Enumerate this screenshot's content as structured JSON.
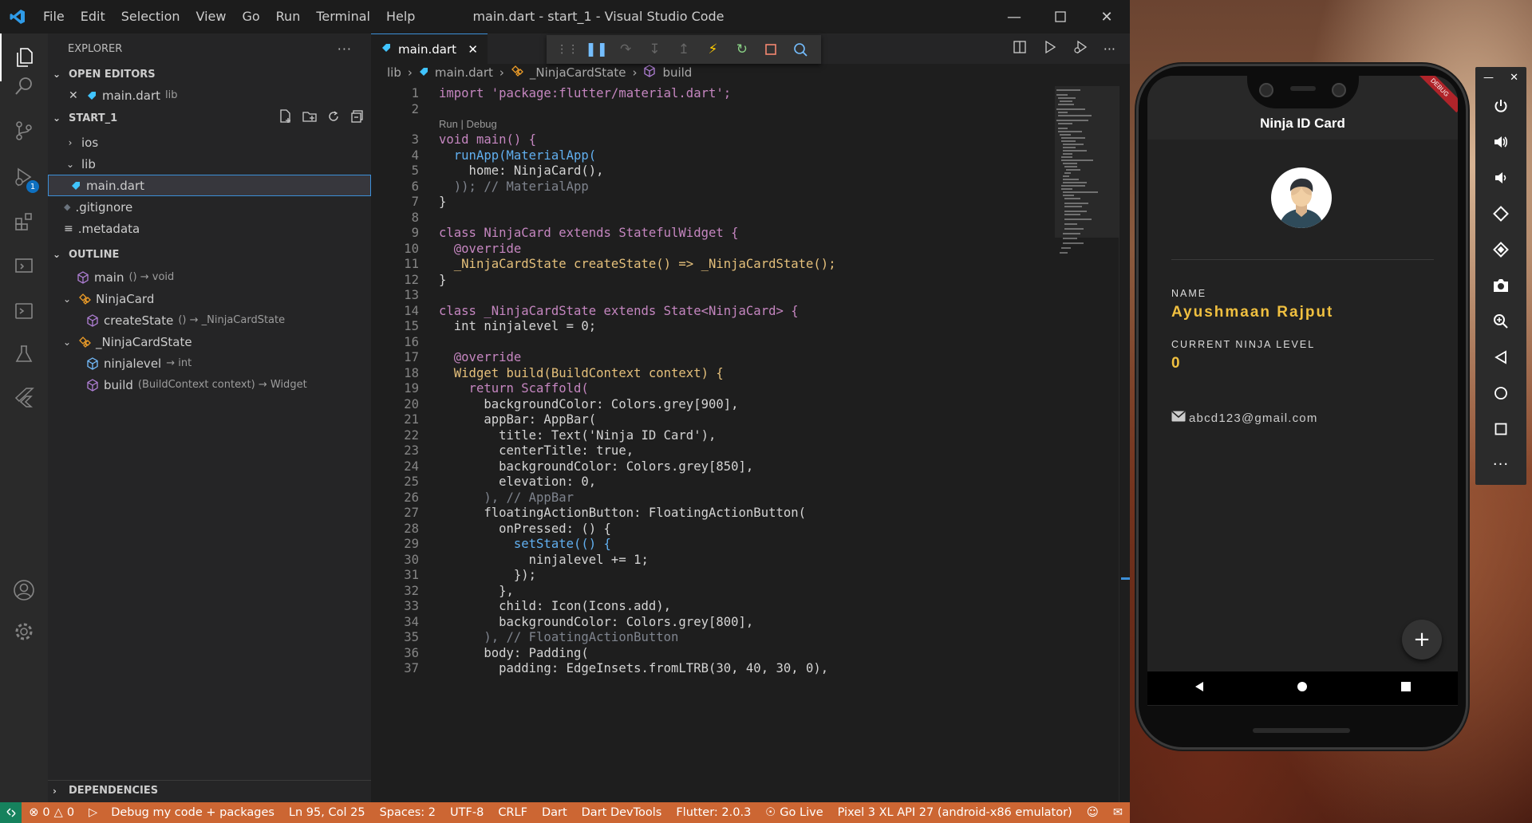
{
  "window": {
    "title": "main.dart - start_1 - Visual Studio Code",
    "menu": [
      "File",
      "Edit",
      "Selection",
      "View",
      "Go",
      "Run",
      "Terminal",
      "Help"
    ]
  },
  "activity": {
    "debug_badge": "1"
  },
  "sidebar": {
    "header": "EXPLORER",
    "open_editors": {
      "title": "OPEN EDITORS",
      "items": [
        {
          "name": "main.dart",
          "path": "lib"
        }
      ]
    },
    "project": {
      "title": "START_1",
      "items": [
        {
          "name": "ios",
          "type": "folder",
          "expanded": false
        },
        {
          "name": "lib",
          "type": "folder",
          "expanded": true
        },
        {
          "name": "main.dart",
          "type": "file",
          "selected": true
        },
        {
          "name": ".gitignore",
          "type": "file"
        },
        {
          "name": ".metadata",
          "type": "file"
        }
      ]
    },
    "outline": {
      "title": "OUTLINE",
      "items": [
        {
          "name": "main",
          "detail": "() → void"
        },
        {
          "name": "NinjaCard",
          "detail": ""
        },
        {
          "name": "createState",
          "detail": "() → _NinjaCardState"
        },
        {
          "name": "_NinjaCardState",
          "detail": ""
        },
        {
          "name": "ninjalevel",
          "detail": "→ int"
        },
        {
          "name": "build",
          "detail": "(BuildContext context) → Widget"
        }
      ]
    },
    "dependencies": {
      "title": "DEPENDENCIES"
    }
  },
  "editor": {
    "tab": "main.dart",
    "breadcrumbs": [
      "lib",
      "main.dart",
      "_NinjaCardState",
      "build"
    ],
    "codelens": "Run | Debug",
    "line_numbers": [
      "1",
      "2",
      "3",
      "4",
      "5",
      "6",
      "7",
      "8",
      "9",
      "10",
      "11",
      "12",
      "13",
      "14",
      "15",
      "16",
      "17",
      "18",
      "19",
      "20",
      "21",
      "22",
      "23",
      "24",
      "25",
      "26",
      "27",
      "28",
      "29",
      "30",
      "31",
      "32",
      "33",
      "34",
      "35",
      "36",
      "37"
    ],
    "code": {
      "l1": "import 'package:flutter/material.dart';",
      "l3": "void main() {",
      "l4": "  runApp(MaterialApp(",
      "l5": "    home: NinjaCard(),",
      "l6": "  )); // MaterialApp",
      "l7": "}",
      "l9": "class NinjaCard extends StatefulWidget {",
      "l10": "  @override",
      "l11": "  _NinjaCardState createState() => _NinjaCardState();",
      "l12": "}",
      "l14": "class _NinjaCardState extends State<NinjaCard> {",
      "l15": "  int ninjalevel = 0;",
      "l17": "  @override",
      "l18": "  Widget build(BuildContext context) {",
      "l19": "    return Scaffold(",
      "l20": "      backgroundColor: Colors.grey[900],",
      "l21": "      appBar: AppBar(",
      "l22": "        title: Text('Ninja ID Card'),",
      "l23": "        centerTitle: true,",
      "l24": "        backgroundColor: Colors.grey[850],",
      "l25": "        elevation: 0,",
      "l26": "      ), // AppBar",
      "l27": "      floatingActionButton: FloatingActionButton(",
      "l28": "        onPressed: () {",
      "l29": "          setState(() {",
      "l30": "            ninjalevel += 1;",
      "l31": "          });",
      "l32": "        },",
      "l33": "        child: Icon(Icons.add),",
      "l34": "        backgroundColor: Colors.grey[800],",
      "l35": "      ), // FloatingActionButton",
      "l36": "      body: Padding(",
      "l37": "        padding: EdgeInsets.fromLTRB(30, 40, 30, 0),"
    }
  },
  "statusbar": {
    "problems": "0",
    "warnings": "0",
    "debug_config": "Debug my code + packages",
    "position": "Ln 95, Col 25",
    "spaces": "Spaces: 2",
    "encoding": "UTF-8",
    "eol": "CRLF",
    "language": "Dart",
    "devtools": "Dart DevTools",
    "flutter": "Flutter: 2.0.3",
    "golive": "Go Live",
    "device": "Pixel 3 XL API 27 (android-x86 emulator)"
  },
  "app": {
    "title": "Ninja ID Card",
    "ribbon": "DEBUG",
    "name_label": "NAME",
    "name_value": "Ayushmaan Rajput",
    "level_label": "CURRENT NINJA LEVEL",
    "level_value": "0",
    "email": "abcd123@gmail.com"
  },
  "colors": {
    "accent": "#3c8fd8",
    "statusbar": "#cc6633",
    "app_gold": "#f0c040",
    "app_bg": "#222222"
  }
}
